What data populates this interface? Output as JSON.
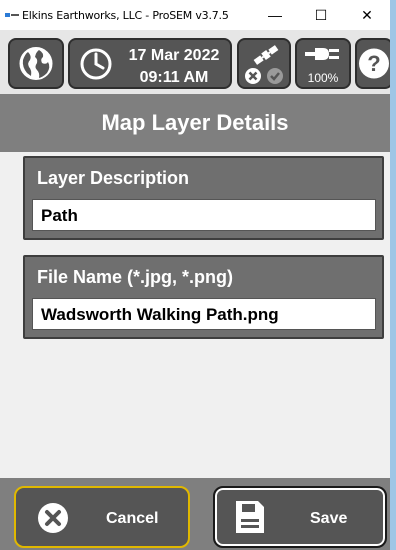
{
  "window": {
    "title": "Elkins Earthworks, LLC - ProSEM v3.7.5",
    "minimize": "—",
    "maximize": "☐",
    "close": "✕"
  },
  "toolbar": {
    "date": "17 Mar 2022",
    "time": "09:11 AM",
    "battery": "100%",
    "icons": [
      "globe-icon",
      "clock-icon",
      "satellite-icon",
      "error-icon",
      "check-icon",
      "power-plug-icon",
      "help-icon"
    ]
  },
  "header": {
    "title": "Map Layer Details"
  },
  "form": {
    "layer_description": {
      "label": "Layer Description",
      "value": "Path"
    },
    "file_name": {
      "label": "File Name (*.jpg, *.png)",
      "value": "Wadsworth Walking Path.png"
    }
  },
  "footer": {
    "cancel_label": "Cancel",
    "save_label": "Save"
  },
  "colors": {
    "header": "#7f7f7f",
    "button": "#555555",
    "focus_border": "#e0b800"
  }
}
